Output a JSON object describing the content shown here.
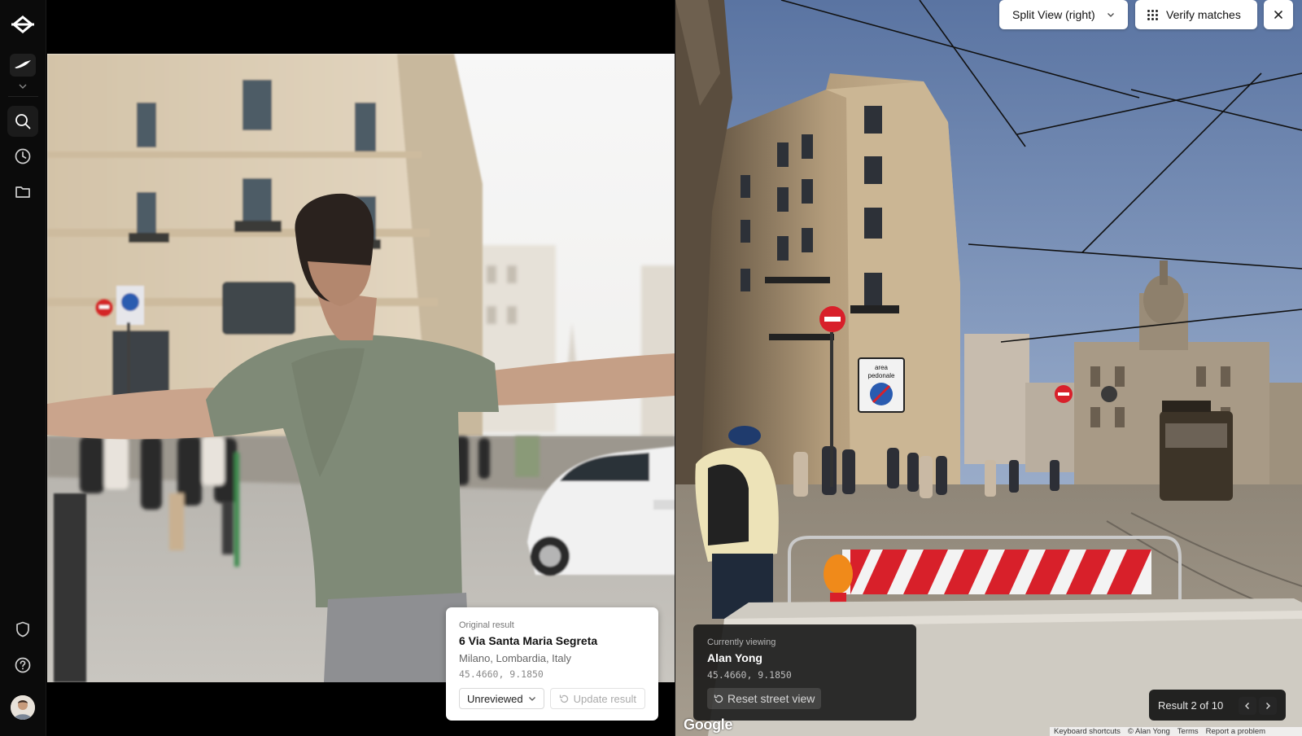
{
  "sidebar": {
    "logo_icon": "app-logo-icon",
    "workspace_icon": "bird-icon",
    "items": [
      {
        "name": "search",
        "icon": "search-icon"
      },
      {
        "name": "history",
        "icon": "clock-icon"
      },
      {
        "name": "folders",
        "icon": "folder-icon"
      }
    ],
    "bottom_items": [
      {
        "name": "privacy",
        "icon": "shield-icon"
      },
      {
        "name": "help",
        "icon": "help-icon"
      }
    ]
  },
  "toolbar": {
    "view_mode": "Split View (right)",
    "verify_label": "Verify matches",
    "close_icon": "close-icon"
  },
  "original_result": {
    "heading": "Original result",
    "address": "6 Via Santa Maria Segreta",
    "region": "Milano, Lombardia, Italy",
    "coords": "45.4660, 9.1850",
    "status": "Unreviewed",
    "update_label": "Update result"
  },
  "street_view": {
    "heading": "Currently viewing",
    "name": "Alan Yong",
    "coords": "45.4660, 9.1850",
    "reset_label": "Reset street view",
    "sign_text_1": "area",
    "sign_text_2": "pedonale"
  },
  "results_nav": {
    "label": "Result 2 of 10"
  },
  "map_attribution": {
    "logo": "Google",
    "links": [
      "Keyboard shortcuts",
      "© Alan Yong",
      "Terms",
      "Report a problem"
    ]
  },
  "colors": {
    "accent_red": "#d8202a",
    "sky": "#6f86ad",
    "sidebar_bg": "#0b0b0b"
  }
}
